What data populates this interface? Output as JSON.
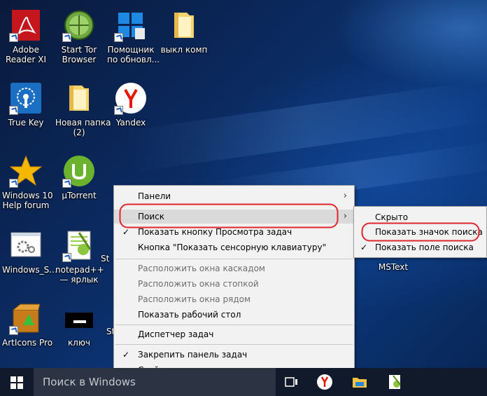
{
  "desktop": {
    "icons": [
      {
        "label": "Adobe\nReader XI",
        "icon": "adobe-reader-icon"
      },
      {
        "label": "Start Tor\nBrowser",
        "icon": "tor-browser-icon"
      },
      {
        "label": "Помощник\nпо обновл...",
        "icon": "windows-update-assistant-icon"
      },
      {
        "label": "выкл комп",
        "icon": "folder-icon"
      },
      {
        "label": "True Key",
        "icon": "true-key-icon"
      },
      {
        "label": "Новая папка\n(2)",
        "icon": "folder-icon"
      },
      {
        "label": "Yandex",
        "icon": "yandex-browser-icon"
      },
      {
        "label": "Windows 10\nHelp forum",
        "icon": "star-icon"
      },
      {
        "label": "µTorrent",
        "icon": "utorrent-icon"
      },
      {
        "label": "Windows_S...",
        "icon": "settings-window-icon"
      },
      {
        "label": "notepad++\n— ярлык",
        "icon": "notepad-plus-plus-icon"
      },
      {
        "label": "St",
        "icon": "partial-icon"
      },
      {
        "label": "ArtIcons Pro",
        "icon": "articons-pro-icon"
      },
      {
        "label": "ключ",
        "icon": "key-window-icon"
      },
      {
        "label": "St",
        "icon": "partial-icon"
      },
      {
        "label": "MSText",
        "icon": "mstext-icon"
      }
    ]
  },
  "context_menu": {
    "items": [
      {
        "label": "Панели",
        "submenu": true
      },
      {
        "label": "Поиск",
        "submenu": true,
        "highlighted": true
      },
      {
        "label": "Показать кнопку Просмотра задач",
        "checked": true
      },
      {
        "label": "Кнопка \"Показать сенсорную клавиатуру\""
      },
      {
        "label": "Расположить окна каскадом",
        "disabled": true
      },
      {
        "label": "Расположить окна стопкой",
        "disabled": true
      },
      {
        "label": "Расположить окна рядом",
        "disabled": true
      },
      {
        "label": "Показать рабочий стол"
      },
      {
        "label": "Диспетчер задач"
      },
      {
        "label": "Закрепить панель задач",
        "checked": true
      },
      {
        "label": "Свойства"
      }
    ]
  },
  "submenu": {
    "items": [
      {
        "label": "Скрыто"
      },
      {
        "label": "Показать значок поиска",
        "circled": true
      },
      {
        "label": "Показать поле поиска",
        "checked": true
      }
    ]
  },
  "glyphs": {
    "check": "✓",
    "arrow": "›"
  },
  "taskbar": {
    "search_placeholder": "Поиск в Windows",
    "icons": [
      "task-view-icon",
      "yandex-icon",
      "file-explorer-icon",
      "notepad-plus-plus-icon"
    ]
  },
  "colors": {
    "annotation_red": "#e0262b",
    "taskbar": "#101a2a",
    "menu_bg": "#f2f2f2"
  }
}
